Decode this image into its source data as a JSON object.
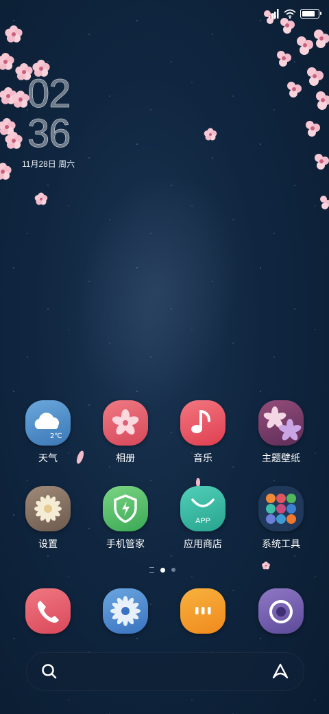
{
  "status_bar": {
    "icons": [
      "signal-icon",
      "wifi-icon",
      "battery-icon"
    ],
    "battery_level": 0.9
  },
  "clock": {
    "hours": "02",
    "minutes": "36",
    "date": "11月28日 周六"
  },
  "apps": [
    {
      "label": "天气",
      "icon": "weather-icon",
      "color": "#4a8dc6"
    },
    {
      "label": "相册",
      "icon": "gallery-icon",
      "color": "#e15a6a"
    },
    {
      "label": "音乐",
      "icon": "music-icon",
      "color": "#e84e5a"
    },
    {
      "label": "主题壁纸",
      "icon": "theme-icon",
      "color": "#7a3f6a"
    },
    {
      "label": "设置",
      "icon": "settings-icon",
      "color": "#8a7565"
    },
    {
      "label": "手机管家",
      "icon": "phone-manager-icon",
      "color": "#58c06a"
    },
    {
      "label": "应用商店",
      "icon": "app-store-icon",
      "color": "#3fbfa8",
      "badge": "APP"
    },
    {
      "label": "系统工具",
      "icon": "system-tools-folder-icon",
      "color": "#1f3b5d"
    }
  ],
  "dock": [
    {
      "icon": "phone-icon",
      "color": "#e05565"
    },
    {
      "icon": "browser-icon",
      "color": "#4d8fd4"
    },
    {
      "icon": "messages-icon",
      "color": "#f39a2a"
    },
    {
      "icon": "camera-icon",
      "color": "#7a63b3"
    }
  ],
  "pages": {
    "count": 3,
    "active": 1
  },
  "search_bar": {
    "icons": [
      "search-icon",
      "assistant-icon"
    ]
  }
}
